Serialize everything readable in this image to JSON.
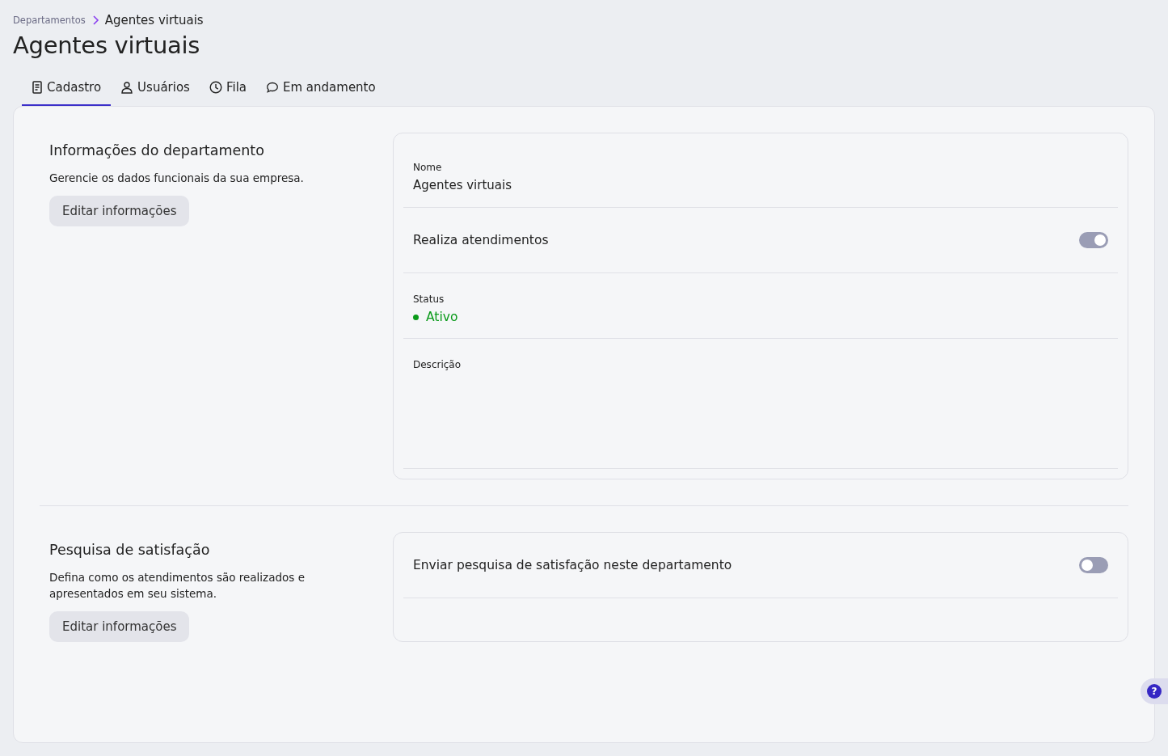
{
  "breadcrumb": {
    "items": [
      "Departamentos"
    ],
    "current": "Agentes virtuais"
  },
  "title": "Agentes virtuais",
  "tabs": [
    {
      "label": "Cadastro",
      "selected": true
    },
    {
      "label": "Usuários",
      "selected": false
    },
    {
      "label": "Fila",
      "selected": false
    },
    {
      "label": "Em andamento",
      "selected": false
    }
  ],
  "sections": [
    {
      "title": "Informações do departamento",
      "description": "Gerencie os dados funcionais da sua empresa.",
      "button": "Editar informações",
      "fields": [
        {
          "kind": "text",
          "label": "Nome",
          "value": "Agentes virtuais"
        },
        {
          "kind": "toggle",
          "label": "Realiza atendimentos",
          "on": true
        },
        {
          "kind": "status",
          "label": "Status",
          "value": "Ativo",
          "color": "#0a9a1a"
        },
        {
          "kind": "textarea",
          "label": "Descrição"
        }
      ]
    },
    {
      "title": "Pesquisa de satisfação",
      "description": "Defina como os atendimentos são realizados e apresentados em seu sistema.",
      "button": "Editar informações",
      "fields": [
        {
          "kind": "toggle",
          "label": "Enviar pesquisa de satisfação neste departamento",
          "on": false
        }
      ]
    }
  ],
  "help_button": "?"
}
